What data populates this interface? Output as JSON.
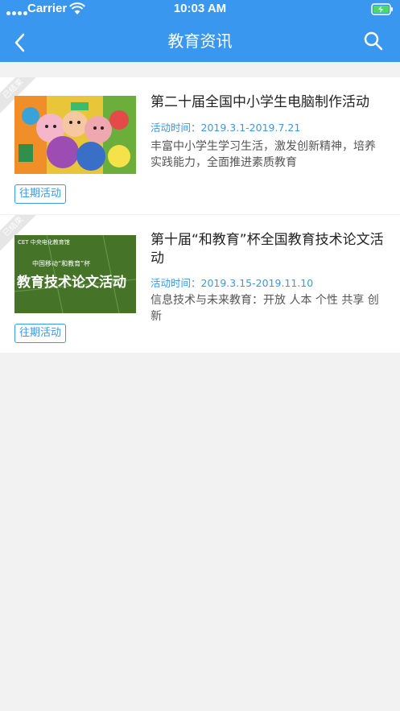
{
  "status_bar": {
    "carrier": "Carrier",
    "time": "10:03 AM"
  },
  "nav": {
    "title": "教育资讯",
    "back_icon": "chevron-left-icon",
    "search_icon": "search-icon"
  },
  "colors": {
    "accent": "#3a97ef",
    "background": "#f2f2f2"
  },
  "articles": [
    {
      "title": "第二十届全国中小学生电脑制作活动",
      "date": "活动时间：2019.3.1-2019.7.21",
      "description": "丰富中小学生学习生活，激发创新精神，培养实践能力，全面推进素质教育",
      "ribbon": "已结束",
      "tag": "往期活动"
    },
    {
      "title": "第十届“和教育”杯全国教育技术论文活动",
      "date": "活动时间：2019.3.15-2019.11.10",
      "description": "信息技术与未来教育：开放 人本 个性 共享 创新",
      "ribbon": "已结束",
      "tag": "往期活动",
      "image_text": {
        "logo": "CET 中央电化教育馆",
        "small": "中国移动“和教育”杯",
        "big": "教育技术论文活动"
      }
    }
  ]
}
